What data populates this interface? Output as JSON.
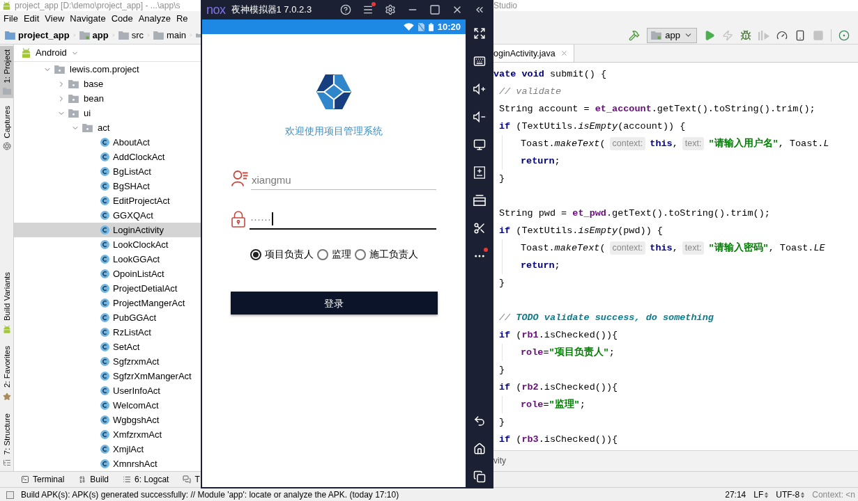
{
  "ide": {
    "title_left": "project_app [D:\\demo\\project_app] - ...\\app\\s",
    "title_right": "Studio",
    "menu": [
      "File",
      "Edit",
      "View",
      "Navigate",
      "Code",
      "Analyze",
      "Re"
    ],
    "breadcrumbs": [
      {
        "kind": "project",
        "label": "project_app"
      },
      {
        "kind": "module",
        "label": "app"
      },
      {
        "kind": "folder",
        "label": "src"
      },
      {
        "kind": "folder",
        "label": "main"
      },
      {
        "kind": "folder"
      }
    ],
    "toolbar": [
      {
        "kind": "build",
        "disabled": false
      },
      {
        "kind": "config",
        "label": "app"
      },
      {
        "kind": "run",
        "disabled": false
      },
      {
        "kind": "apply",
        "disabled": true
      },
      {
        "kind": "debug",
        "disabled": false
      },
      {
        "kind": "attach",
        "disabled": true
      },
      {
        "kind": "profile",
        "disabled": false
      },
      {
        "kind": "device",
        "disabled": false
      },
      {
        "kind": "stop",
        "disabled": true
      },
      {
        "kind": "separator"
      },
      {
        "kind": "sdk",
        "disabled": false
      }
    ],
    "project_view": "Android",
    "tree": [
      {
        "kind": "package",
        "label": "lewis.com.project",
        "expanded": true,
        "selected": false,
        "children": [
          {
            "kind": "package",
            "label": "base",
            "expanded": false,
            "selected": false
          },
          {
            "kind": "package",
            "label": "bean",
            "expanded": false,
            "selected": false
          },
          {
            "kind": "package",
            "label": "ui",
            "expanded": true,
            "selected": false,
            "children": [
              {
                "kind": "package",
                "label": "act",
                "expanded": true,
                "selected": false,
                "children": [
                  {
                    "kind": "class",
                    "label": "AboutAct",
                    "selected": false
                  },
                  {
                    "kind": "class",
                    "label": "AddClockAct",
                    "selected": false
                  },
                  {
                    "kind": "class",
                    "label": "BgListAct",
                    "selected": false
                  },
                  {
                    "kind": "class",
                    "label": "BgSHAct",
                    "selected": false
                  },
                  {
                    "kind": "class",
                    "label": "EditProjectAct",
                    "selected": false
                  },
                  {
                    "kind": "class",
                    "label": "GGXQAct",
                    "selected": false
                  },
                  {
                    "kind": "class",
                    "label": "LoginActivity",
                    "selected": true
                  },
                  {
                    "kind": "class",
                    "label": "LookClockAct",
                    "selected": false
                  },
                  {
                    "kind": "class",
                    "label": "LookGGAct",
                    "selected": false
                  },
                  {
                    "kind": "class",
                    "label": "OpoinListAct",
                    "selected": false
                  },
                  {
                    "kind": "class",
                    "label": "ProjectDetialAct",
                    "selected": false
                  },
                  {
                    "kind": "class",
                    "label": "ProjectMangerAct",
                    "selected": false
                  },
                  {
                    "kind": "class",
                    "label": "PubGGAct",
                    "selected": false
                  },
                  {
                    "kind": "class",
                    "label": "RzListAct",
                    "selected": false
                  },
                  {
                    "kind": "class",
                    "label": "SetAct",
                    "selected": false
                  },
                  {
                    "kind": "class",
                    "label": "SgfzrxmAct",
                    "selected": false
                  },
                  {
                    "kind": "class",
                    "label": "SgfzrXmMangerAct",
                    "selected": false
                  },
                  {
                    "kind": "class",
                    "label": "UserInfoAct",
                    "selected": false
                  },
                  {
                    "kind": "class",
                    "label": "WelcomAct",
                    "selected": false
                  },
                  {
                    "kind": "class",
                    "label": "WgbgshAct",
                    "selected": false
                  },
                  {
                    "kind": "class",
                    "label": "XmfzrxmAct",
                    "selected": false
                  },
                  {
                    "kind": "class",
                    "label": "XmjlAct",
                    "selected": false
                  },
                  {
                    "kind": "class",
                    "label": "XmnrshAct",
                    "selected": false
                  }
                ]
              }
            ]
          }
        ]
      }
    ],
    "tool_strip": {
      "top": [
        {
          "kind": "project",
          "label": "1: Project",
          "selected": true
        },
        {
          "kind": "captures",
          "label": "Captures",
          "selected": false
        }
      ],
      "bottom": [
        {
          "kind": "build_variants",
          "label": "Build Variants",
          "selected": false
        },
        {
          "kind": "favorites",
          "label": "2: Favorites",
          "selected": false
        },
        {
          "kind": "structure",
          "label": "7: Structure",
          "selected": false
        }
      ]
    },
    "editor": {
      "tabs": [
        {
          "label": "oginActivity.java",
          "selected": true
        }
      ],
      "lines": [
        {
          "kind": "code",
          "tokens": [
            {
              "kind": "keyword",
              "text": "vate void"
            },
            {
              "kind": "plain",
              "text": " submit() {"
            }
          ],
          "children": [
            {
              "kind": "code",
              "tokens": [
                {
                  "kind": "comment",
                  "text": "// validate"
                }
              ]
            },
            {
              "kind": "code",
              "tokens": [
                {
                  "kind": "plain",
                  "text": "String account = "
                },
                {
                  "kind": "field",
                  "text": "et_account"
                },
                {
                  "kind": "plain",
                  "text": ".getText().toString().trim();"
                }
              ]
            },
            {
              "kind": "code",
              "tokens": [
                {
                  "kind": "keyword",
                  "text": "if"
                },
                {
                  "kind": "plain",
                  "text": " (TextUtils."
                },
                {
                  "kind": "static",
                  "text": "isEmpty"
                },
                {
                  "kind": "plain",
                  "text": "(account)) {"
                }
              ],
              "children": [
                {
                  "kind": "code",
                  "tokens": [
                    {
                      "kind": "plain",
                      "text": "Toast."
                    },
                    {
                      "kind": "static",
                      "text": "makeText"
                    },
                    {
                      "kind": "plain",
                      "text": "("
                    },
                    {
                      "kind": "hint",
                      "text": "context:"
                    },
                    {
                      "kind": "keyword",
                      "text": "this"
                    },
                    {
                      "kind": "plain",
                      "text": ","
                    },
                    {
                      "kind": "hint",
                      "text": "text:"
                    },
                    {
                      "kind": "string",
                      "text": "\"请输入用户名\""
                    },
                    {
                      "kind": "plain",
                      "text": ", Toast."
                    },
                    {
                      "kind": "static",
                      "text": "L"
                    }
                  ]
                },
                {
                  "kind": "code",
                  "tokens": [
                    {
                      "kind": "keyword",
                      "text": "return"
                    },
                    {
                      "kind": "plain",
                      "text": ";"
                    }
                  ]
                }
              ]
            },
            {
              "kind": "code",
              "tokens": [
                {
                  "kind": "plain",
                  "text": "}"
                }
              ]
            },
            {
              "kind": "blank"
            },
            {
              "kind": "code",
              "tokens": [
                {
                  "kind": "plain",
                  "text": "String pwd = "
                },
                {
                  "kind": "field",
                  "text": "et_pwd"
                },
                {
                  "kind": "plain",
                  "text": ".getText().toString().trim();"
                }
              ]
            },
            {
              "kind": "code",
              "tokens": [
                {
                  "kind": "keyword",
                  "text": "if"
                },
                {
                  "kind": "plain",
                  "text": " (TextUtils."
                },
                {
                  "kind": "static",
                  "text": "isEmpty"
                },
                {
                  "kind": "plain",
                  "text": "(pwd)) {"
                }
              ],
              "children": [
                {
                  "kind": "code",
                  "tokens": [
                    {
                      "kind": "plain",
                      "text": "Toast."
                    },
                    {
                      "kind": "static",
                      "text": "makeText"
                    },
                    {
                      "kind": "plain",
                      "text": "("
                    },
                    {
                      "kind": "hint",
                      "text": "context:"
                    },
                    {
                      "kind": "keyword",
                      "text": "this"
                    },
                    {
                      "kind": "plain",
                      "text": ","
                    },
                    {
                      "kind": "hint",
                      "text": "text:"
                    },
                    {
                      "kind": "string",
                      "text": "\"请输入密码\""
                    },
                    {
                      "kind": "plain",
                      "text": ", Toast."
                    },
                    {
                      "kind": "static",
                      "text": "LE"
                    }
                  ]
                },
                {
                  "kind": "code",
                  "tokens": [
                    {
                      "kind": "keyword",
                      "text": "return"
                    },
                    {
                      "kind": "plain",
                      "text": ";"
                    }
                  ]
                }
              ]
            },
            {
              "kind": "code",
              "tokens": [
                {
                  "kind": "plain",
                  "text": "}"
                }
              ]
            },
            {
              "kind": "blank"
            },
            {
              "kind": "code",
              "tokens": [
                {
                  "kind": "comment",
                  "text": "// "
                },
                {
                  "kind": "todo",
                  "text": "TODO validate success, do something"
                }
              ]
            },
            {
              "kind": "code",
              "tokens": [
                {
                  "kind": "keyword",
                  "text": "if"
                },
                {
                  "kind": "plain",
                  "text": " ("
                },
                {
                  "kind": "field",
                  "text": "rb1"
                },
                {
                  "kind": "plain",
                  "text": ".isChecked()){"
                }
              ],
              "children": [
                {
                  "kind": "code",
                  "tokens": [
                    {
                      "kind": "field",
                      "text": "role"
                    },
                    {
                      "kind": "plain",
                      "text": "="
                    },
                    {
                      "kind": "string",
                      "text": "\"项目负责人\""
                    },
                    {
                      "kind": "plain",
                      "text": ";"
                    }
                  ]
                }
              ]
            },
            {
              "kind": "code",
              "tokens": [
                {
                  "kind": "plain",
                  "text": "}"
                }
              ]
            },
            {
              "kind": "code",
              "tokens": [
                {
                  "kind": "keyword",
                  "text": "if"
                },
                {
                  "kind": "plain",
                  "text": " ("
                },
                {
                  "kind": "field",
                  "text": "rb2"
                },
                {
                  "kind": "plain",
                  "text": ".isChecked()){"
                }
              ],
              "children": [
                {
                  "kind": "code",
                  "tokens": [
                    {
                      "kind": "field",
                      "text": "role"
                    },
                    {
                      "kind": "plain",
                      "text": "="
                    },
                    {
                      "kind": "string",
                      "text": "\"监理\""
                    },
                    {
                      "kind": "plain",
                      "text": ";"
                    }
                  ]
                }
              ]
            },
            {
              "kind": "code",
              "tokens": [
                {
                  "kind": "plain",
                  "text": "}"
                }
              ]
            },
            {
              "kind": "code",
              "tokens": [
                {
                  "kind": "keyword",
                  "text": "if"
                },
                {
                  "kind": "plain",
                  "text": " ("
                },
                {
                  "kind": "field",
                  "text": "rb3"
                },
                {
                  "kind": "plain",
                  "text": ".isChecked()){"
                }
              ]
            }
          ]
        }
      ],
      "breadcrumb": "vity"
    },
    "tool_windows": [
      {
        "kind": "terminal",
        "label": "Terminal"
      },
      {
        "kind": "build",
        "label": "Build"
      },
      {
        "kind": "logcat",
        "label": "6: Logcat"
      },
      {
        "kind": "todo",
        "label": "T"
      }
    ],
    "status_bar": {
      "message": "Build APK(s): APK(s) generated successfully: // Module 'app': locate or analyze the APK. (today 17:10)",
      "position": "27:14",
      "line_separator": "LF",
      "encoding": "UTF-8",
      "context": "Context: <n"
    }
  },
  "emulator": {
    "logo": "nox",
    "title": "夜神模拟器1 7.0.2.3",
    "title_buttons": [
      {
        "kind": "help",
        "badge": false
      },
      {
        "kind": "menu",
        "badge": true
      },
      {
        "kind": "settings",
        "badge": false
      },
      {
        "kind": "minimize",
        "badge": false
      },
      {
        "kind": "maximize",
        "badge": false
      },
      {
        "kind": "close",
        "badge": false
      },
      {
        "kind": "collapse",
        "badge": false
      }
    ],
    "clock": "10:20",
    "app": {
      "heading": "欢迎使用项目管理系统",
      "username": {
        "value": "xiangmu",
        "focused": false
      },
      "password": {
        "value": "······",
        "focused": true
      },
      "roles": [
        {
          "label": "项目负责人",
          "selected": true
        },
        {
          "label": "监理",
          "selected": false
        },
        {
          "label": "施工负责人",
          "selected": false
        }
      ],
      "login_button": "登录"
    },
    "sidebar": [
      {
        "kind": "fullscreen",
        "badge": false
      },
      {
        "kind": "keyboard",
        "badge": false
      },
      {
        "kind": "volume_up",
        "badge": false
      },
      {
        "kind": "volume_down",
        "badge": false
      },
      {
        "kind": "screen",
        "badge": false
      },
      {
        "kind": "apk",
        "badge": false
      },
      {
        "kind": "multi",
        "badge": false
      },
      {
        "kind": "scissors",
        "badge": false
      },
      {
        "kind": "more",
        "badge": true
      }
    ],
    "nav_buttons": [
      {
        "kind": "back"
      },
      {
        "kind": "home"
      },
      {
        "kind": "recents"
      }
    ]
  }
}
